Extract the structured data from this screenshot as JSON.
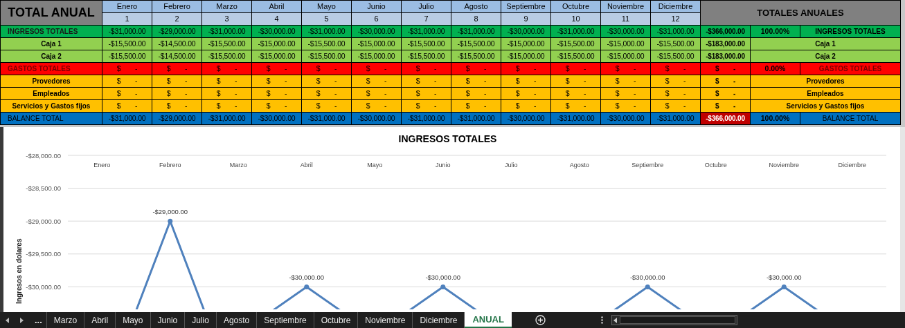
{
  "sheet_title": "TOTAL ANUAL",
  "months": [
    {
      "name": "Enero",
      "number": "1"
    },
    {
      "name": "Febrero",
      "number": "2"
    },
    {
      "name": "Marzo",
      "number": "3"
    },
    {
      "name": "Abril",
      "number": "4"
    },
    {
      "name": "Mayo",
      "number": "5"
    },
    {
      "name": "Junio",
      "number": "6"
    },
    {
      "name": "Julio",
      "number": "7"
    },
    {
      "name": "Agosto",
      "number": "8"
    },
    {
      "name": "Septiembre",
      "number": "9"
    },
    {
      "name": "Octubre",
      "number": "10"
    },
    {
      "name": "Noviembre",
      "number": "11"
    },
    {
      "name": "Diciembre",
      "number": "12"
    }
  ],
  "totals_header": "TOTALES ANUALES",
  "rows": [
    {
      "kind": "income_total",
      "label": "INGRESOS TOTALES",
      "values": [
        "-$31,000.00",
        "-$29,000.00",
        "-$31,000.00",
        "-$30,000.00",
        "-$31,000.00",
        "-$30,000.00",
        "-$31,000.00",
        "-$31,000.00",
        "-$30,000.00",
        "-$31,000.00",
        "-$30,000.00",
        "-$31,000.00"
      ],
      "total": "-$366,000.00",
      "percent": "100.00%",
      "summary_label": "INGRESOS TOTALES"
    },
    {
      "kind": "income",
      "label": "Caja 1",
      "values": [
        "-$15,500.00",
        "-$14,500.00",
        "-$15,500.00",
        "-$15,000.00",
        "-$15,500.00",
        "-$15,000.00",
        "-$15,500.00",
        "-$15,500.00",
        "-$15,000.00",
        "-$15,500.00",
        "-$15,000.00",
        "-$15,500.00"
      ],
      "total": "-$183,000.00",
      "summary_label": "Caja 1"
    },
    {
      "kind": "income",
      "label": "Caja 2",
      "values": [
        "-$15,500.00",
        "-$14,500.00",
        "-$15,500.00",
        "-$15,000.00",
        "-$15,500.00",
        "-$15,000.00",
        "-$15,500.00",
        "-$15,500.00",
        "-$15,000.00",
        "-$15,500.00",
        "-$15,000.00",
        "-$15,500.00"
      ],
      "total": "-$183,000.00",
      "summary_label": "Caja 2"
    },
    {
      "kind": "expense_total",
      "label": "GASTOS TOTALES",
      "values": [
        "$ -",
        "$ -",
        "$ -",
        "$ -",
        "$ -",
        "$ -",
        "$ -",
        "$ -",
        "$ -",
        "$ -",
        "$ -",
        "$ -"
      ],
      "total": "$ -",
      "percent": "0.00%",
      "summary_label": "GASTOS TOTALES"
    },
    {
      "kind": "expense",
      "label": "Provedores",
      "values": [
        "$ -",
        "$ -",
        "$ -",
        "$ -",
        "$ -",
        "$ -",
        "$ -",
        "$ -",
        "$ -",
        "$ -",
        "$ -",
        "$ -"
      ],
      "total": "$ -",
      "summary_label": "Provedores"
    },
    {
      "kind": "expense",
      "label": "Empleados",
      "values": [
        "$ -",
        "$ -",
        "$ -",
        "$ -",
        "$ -",
        "$ -",
        "$ -",
        "$ -",
        "$ -",
        "$ -",
        "$ -",
        "$ -"
      ],
      "total": "$ -",
      "summary_label": "Empleados"
    },
    {
      "kind": "expense",
      "label": "Servicios y Gastos fijos",
      "values": [
        "$ -",
        "$ -",
        "$ -",
        "$ -",
        "$ -",
        "$ -",
        "$ -",
        "$ -",
        "$ -",
        "$ -",
        "$ -",
        "$ -"
      ],
      "total": "$ -",
      "summary_label": "Servicios y Gastos fijos"
    },
    {
      "kind": "balance",
      "label": "BALANCE TOTAL",
      "values": [
        "-$31,000.00",
        "-$29,000.00",
        "-$31,000.00",
        "-$30,000.00",
        "-$31,000.00",
        "-$30,000.00",
        "-$31,000.00",
        "-$31,000.00",
        "-$30,000.00",
        "-$31,000.00",
        "-$30,000.00",
        "-$31,000.00"
      ],
      "total": "-$366,000.00",
      "total_alert": true,
      "percent": "100.00%",
      "summary_label": "BALANCE TOTAL"
    }
  ],
  "chart": {
    "chart_data": {
      "type": "line",
      "title": "INGRESOS TOTALES",
      "ylabel": "Ingresos en dolares",
      "categories": [
        "Enero",
        "Febrero",
        "Marzo",
        "Abril",
        "Mayo",
        "Junio",
        "Julio",
        "Agosto",
        "Septiembre",
        "Octubre",
        "Noviembre",
        "Diciembre"
      ],
      "grid": true,
      "ylim": [
        -30000,
        -28000
      ],
      "series": [
        {
          "color": "#4f81bd",
          "marker": "circle",
          "values": [
            null,
            -29000,
            null,
            -30000,
            null,
            -30000,
            null,
            null,
            -30000,
            null,
            -30000,
            null
          ]
        }
      ],
      "yticks": [
        {
          "value": -28000,
          "label": "-$28,000.00"
        },
        {
          "value": -28500,
          "label": "-$28,500.00"
        },
        {
          "value": -29000,
          "label": "-$29,000.00"
        },
        {
          "value": -29500,
          "label": "-$29,500.00"
        },
        {
          "value": -30000,
          "label": "-$30,000.00"
        }
      ],
      "value_labels": [
        null,
        "-$29,000.00",
        null,
        "-$30,000.00",
        null,
        "-$30,000.00",
        null,
        null,
        "-$30,000.00",
        null,
        "-$30,000.00",
        null
      ]
    }
  },
  "sheet_bar": {
    "overflow": "...",
    "tabs": [
      {
        "label": "Marzo",
        "selected": false
      },
      {
        "label": "Abril",
        "selected": false
      },
      {
        "label": "Mayo",
        "selected": false
      },
      {
        "label": "Junio",
        "selected": false
      },
      {
        "label": "Julio",
        "selected": false
      },
      {
        "label": "Agosto",
        "selected": false
      },
      {
        "label": "Septiembre",
        "selected": false
      },
      {
        "label": "Octubre",
        "selected": false
      },
      {
        "label": "Noviembre",
        "selected": false
      },
      {
        "label": "Diciembre",
        "selected": false
      },
      {
        "label": "ANUAL",
        "selected": true
      }
    ]
  }
}
